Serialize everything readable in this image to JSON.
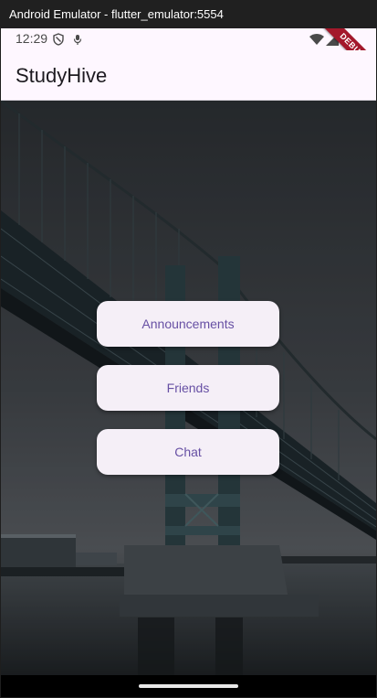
{
  "window": {
    "title": "Android Emulator - flutter_emulator:5554"
  },
  "status_bar": {
    "time": "12:29",
    "icons": [
      "shield-icon",
      "mic-icon",
      "wifi-icon",
      "signal-icon"
    ]
  },
  "debug_banner": {
    "label": "DEBUG",
    "color": "#a3182b"
  },
  "app_bar": {
    "title": "StudyHive"
  },
  "menu": {
    "buttons": [
      {
        "label": "Announcements"
      },
      {
        "label": "Friends"
      },
      {
        "label": "Chat"
      }
    ]
  },
  "colors": {
    "surface": "#fef7ff",
    "button_bg": "#f5eff7",
    "button_text": "#6750a4"
  }
}
